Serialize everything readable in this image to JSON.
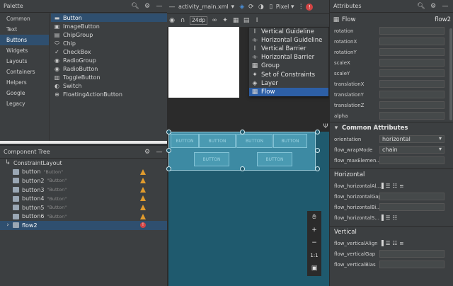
{
  "palette": {
    "title": "Palette",
    "categories": [
      "Common",
      "Text",
      "Buttons",
      "Widgets",
      "Layouts",
      "Containers",
      "Helpers",
      "Google",
      "Legacy"
    ],
    "selected_category": "Buttons",
    "items": [
      {
        "label": "Button",
        "icon": "button-icon"
      },
      {
        "label": "ImageButton",
        "icon": "image-icon"
      },
      {
        "label": "ChipGroup",
        "icon": "chipgroup-icon"
      },
      {
        "label": "Chip",
        "icon": "chip-icon"
      },
      {
        "label": "CheckBox",
        "icon": "check-icon"
      },
      {
        "label": "RadioGroup",
        "icon": "radiogroup-icon"
      },
      {
        "label": "RadioButton",
        "icon": "radio-icon"
      },
      {
        "label": "ToggleButton",
        "icon": "toggle-icon"
      },
      {
        "label": "Switch",
        "icon": "switch-icon"
      },
      {
        "label": "FloatingActionButton",
        "icon": "fab-icon"
      }
    ]
  },
  "tree": {
    "title": "Component Tree",
    "root": "ConstraintLayout",
    "children": [
      {
        "id": "button",
        "text": "\"Button\"",
        "status": "warning"
      },
      {
        "id": "button2",
        "text": "\"Button\"",
        "status": "warning"
      },
      {
        "id": "button3",
        "text": "\"Button\"",
        "status": "warning"
      },
      {
        "id": "button4",
        "text": "\"Button\"",
        "status": "warning"
      },
      {
        "id": "button5",
        "text": "\"Button\"",
        "status": "warning"
      },
      {
        "id": "button6",
        "text": "\"Button\"",
        "status": "warning"
      },
      {
        "id": "flow2",
        "text": "",
        "status": "error"
      }
    ]
  },
  "editor": {
    "tab": "activity_main.xml",
    "device": "Pixel",
    "dp": "24dp",
    "flow_buttons": [
      "BUTTON",
      "BUTTON",
      "BUTTON",
      "BUTTON",
      "BUTTON",
      "BUTTON"
    ]
  },
  "dropdown": {
    "items": [
      {
        "label": "Vertical Guideline",
        "icon": "vertical-guideline-icon"
      },
      {
        "label": "Horizontal Guideline",
        "icon": "horizontal-guideline-icon"
      },
      {
        "label": "Vertical Barrier",
        "icon": "vertical-barrier-icon"
      },
      {
        "label": "Horizontal Barrier",
        "icon": "horizontal-barrier-icon"
      },
      {
        "label": "Group",
        "icon": "group-icon"
      },
      {
        "label": "Set of Constraints",
        "icon": "constraints-icon"
      },
      {
        "label": "Layer",
        "icon": "layer-icon"
      },
      {
        "label": "Flow",
        "icon": "flow-icon"
      }
    ],
    "selected": "Flow"
  },
  "attributes": {
    "title": "Attributes",
    "component_type": "Flow",
    "component_id": "flow2",
    "transform_rows": [
      "rotation",
      "rotationX",
      "rotationY",
      "scaleX",
      "scaleY",
      "translationX",
      "translationY",
      "translationZ",
      "alpha"
    ],
    "common_title": "Common Attributes",
    "orientation_label": "orientation",
    "orientation_value": "horizontal",
    "wrap_label": "flow_wrapMode",
    "wrap_value": "chain",
    "max_label": "flow_maxElemen...",
    "horizontal_title": "Horizontal",
    "horizontal_rows": [
      "flow_horizontalAl...",
      "flow_horizontalGap",
      "flow_horizontalBi...",
      "flow_horizontalS..."
    ],
    "vertical_title": "Vertical",
    "vertical_rows": [
      "flow_verticalAlign",
      "flow_verticalGap",
      "flow_verticalBias"
    ]
  }
}
